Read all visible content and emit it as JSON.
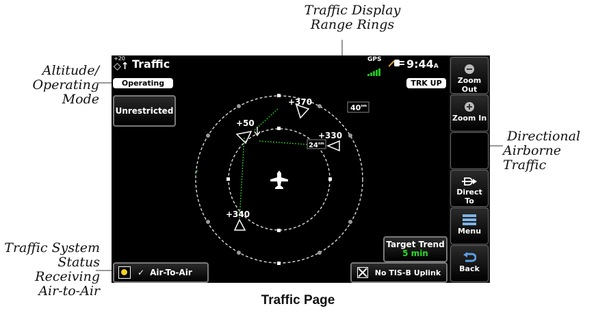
{
  "callouts": {
    "range_rings": [
      "Traffic Display",
      "Range Rings"
    ],
    "altitude_mode": [
      "Altitude/",
      "Operating",
      "Mode"
    ],
    "directional": [
      "Directional",
      "Airborne Traffic"
    ],
    "system_status": [
      "Traffic System",
      "Status Receiving",
      "Air-to-Air"
    ]
  },
  "header": {
    "alt_filter": "+20",
    "title": "Traffic",
    "gps_label": "GPS",
    "time": "9:44",
    "time_suffix": "A"
  },
  "map": {
    "mode_pill": "Operating",
    "orientation_pill": "TRK UP",
    "altitude_filter_button": "Unrestricted",
    "outer_range": "40",
    "inner_range": "24",
    "range_unit": "nm",
    "target_trend_label": "Target Trend",
    "target_trend_value": "5 min",
    "status_label": "Air-To-Air",
    "status_check": "✓",
    "tisb_label": "No TIS-B Uplink"
  },
  "traffic": [
    {
      "label": "+370"
    },
    {
      "label": "+50"
    },
    {
      "label": "+330"
    },
    {
      "label": "+340"
    }
  ],
  "sidebar": {
    "zoom_out": "Zoom Out",
    "zoom_in": "Zoom In",
    "direct_to": "Direct To",
    "menu": "Menu",
    "back": "Back"
  },
  "caption": "Traffic Page",
  "colors": {
    "screen_bg": "#000000",
    "ownship": "#ffffff",
    "trend_line": "#22cc22",
    "gps_bars": "#1fc21f",
    "target_trend_value": "#22dd22",
    "status_icon": "#f2d12a"
  }
}
